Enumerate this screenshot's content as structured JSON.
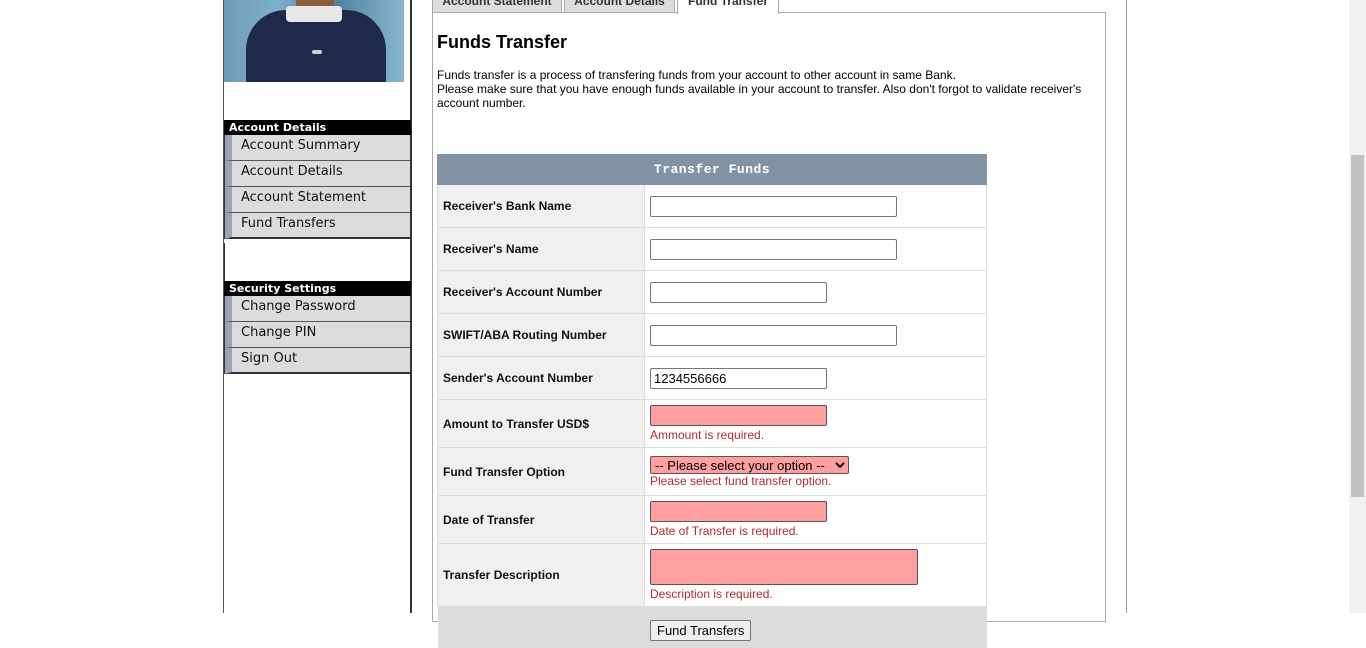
{
  "tabs": [
    "Account Statement",
    "Account Details",
    "Fund Transfer"
  ],
  "sidebar": {
    "account_header": "Account Details",
    "account_items": [
      "Account Summary",
      "Account Details",
      "Account Statement",
      "Fund Transfers"
    ],
    "security_header": "Security Settings",
    "security_items": [
      "Change Password",
      "Change PIN",
      "Sign Out"
    ]
  },
  "main": {
    "title": "Funds Transfer",
    "intro_line1": "Funds transfer is a process of transfering funds from your account to other account in same Bank.",
    "intro_line2": "Please make sure that you have enough funds available in your account to transfer. Also don't forgot to validate receiver's account number."
  },
  "form": {
    "header": "Transfer Funds",
    "receiver_bank_label": "Receiver's Bank Name",
    "receiver_bank_value": "",
    "receiver_name_label": "Receiver's Name",
    "receiver_name_value": "",
    "receiver_account_label": "Receiver's Account Number",
    "receiver_account_value": "",
    "routing_label": "SWIFT/ABA Routing Number",
    "routing_value": "",
    "sender_account_label": "Sender's Account Number",
    "sender_account_value": "1234556666",
    "amount_label": "Amount to Transfer USD$",
    "amount_value": "",
    "amount_error": "Ammount is required.",
    "option_label": "Fund Transfer Option",
    "option_selected": "-- Please select your option --",
    "option_error": "Please select fund transfer option.",
    "date_label": "Date of Transfer",
    "date_value": "",
    "date_error": "Date of Transfer is required.",
    "description_label": "Transfer Description",
    "description_value": "",
    "description_error": "Description is required.",
    "submit_label": "Fund Transfers"
  }
}
